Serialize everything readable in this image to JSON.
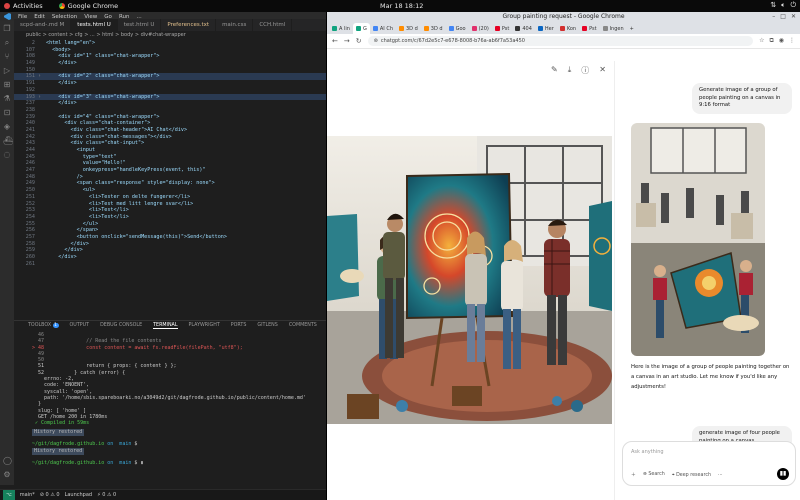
{
  "topbar": {
    "activities": "Activities",
    "app_name": "Google Chrome",
    "clock": "Mar 18  18:12",
    "tray_icons": [
      "network-icon",
      "volume-icon",
      "power-icon"
    ]
  },
  "vscode": {
    "menu": [
      "File",
      "Edit",
      "Selection",
      "View",
      "Go",
      "Run",
      "..."
    ],
    "tabs": [
      {
        "label": "scpd-and-.md M",
        "state": "normal"
      },
      {
        "label": "tests.html U",
        "state": "active"
      },
      {
        "label": "test.html U",
        "state": "normal"
      },
      {
        "label": "Preferences.txt",
        "state": "modified"
      },
      {
        "label": "main.css",
        "state": "normal"
      },
      {
        "label": "CCH.html",
        "state": "normal"
      }
    ],
    "breadcrumb": "public > content > cfg > ... > html > body > div#chat-wrapper",
    "code_lines": [
      {
        "n": "2",
        "text": "<html lang=\"en\">",
        "hl": false
      },
      {
        "n": "107",
        "text": "  <body>",
        "hl": false
      },
      {
        "n": "108",
        "text": "    <div id=\"1\" class=\"chat-wrapper\">",
        "hl": false
      },
      {
        "n": "149",
        "text": "    </div>",
        "hl": false
      },
      {
        "n": "150",
        "text": "",
        "hl": false
      },
      {
        "n": "151",
        "text": "    <div id=\"2\" class=\"chat-wrapper\">",
        "hl": true
      },
      {
        "n": "191",
        "text": "    </div>",
        "hl": false
      },
      {
        "n": "192",
        "text": "",
        "hl": false
      },
      {
        "n": "193",
        "text": "    <div id=\"3\" class=\"chat-wrapper\">",
        "hl": true
      },
      {
        "n": "237",
        "text": "    </div>",
        "hl": false
      },
      {
        "n": "238",
        "text": "",
        "hl": false
      },
      {
        "n": "239",
        "text": "    <div id=\"4\" class=\"chat-wrapper\">",
        "hl": false
      },
      {
        "n": "240",
        "text": "      <div class=\"chat-container\">",
        "hl": false
      },
      {
        "n": "241",
        "text": "        <div class=\"chat-header\">AI Chat</div>",
        "hl": false
      },
      {
        "n": "242",
        "text": "        <div class=\"chat-messages\"></div>",
        "hl": false
      },
      {
        "n": "243",
        "text": "        <div class=\"chat-input\">",
        "hl": false
      },
      {
        "n": "244",
        "text": "          <input",
        "hl": false
      },
      {
        "n": "245",
        "text": "            type=\"text\"",
        "hl": false
      },
      {
        "n": "246",
        "text": "            value=\"Hello!\"",
        "hl": false
      },
      {
        "n": "247",
        "text": "            onkeypress=\"handleKeyPress(event, this)\"",
        "hl": false
      },
      {
        "n": "248",
        "text": "          />",
        "hl": false
      },
      {
        "n": "249",
        "text": "          <span class=\"response\" style=\"display: none\">",
        "hl": false
      },
      {
        "n": "250",
        "text": "            <ul>",
        "hl": false
      },
      {
        "n": "251",
        "text": "              <li>Tester on delte fungerer</li>",
        "hl": false
      },
      {
        "n": "252",
        "text": "              <li>Test med litt lengre svar</li>",
        "hl": false
      },
      {
        "n": "253",
        "text": "              <li>Test</li>",
        "hl": false
      },
      {
        "n": "254",
        "text": "              <li>Test</li>",
        "hl": false
      },
      {
        "n": "255",
        "text": "            </ul>",
        "hl": false
      },
      {
        "n": "256",
        "text": "          </span>",
        "hl": false
      },
      {
        "n": "257",
        "text": "          <button onclick=\"sendMessage(this)\">Send</button>",
        "hl": false
      },
      {
        "n": "258",
        "text": "        </div>",
        "hl": false
      },
      {
        "n": "259",
        "text": "      </div>",
        "hl": false
      },
      {
        "n": "260",
        "text": "    </div>",
        "hl": false
      },
      {
        "n": "261",
        "text": "",
        "hl": false
      }
    ],
    "panel_tabs": [
      "TOOLBOX",
      "OUTPUT",
      "DEBUG CONSOLE",
      "TERMINAL",
      "PLAYWRIGHT",
      "PORTS",
      "GITLENS",
      "COMMENTS"
    ],
    "toolbox_badge": "1",
    "terminal_lines": [
      {
        "text": "  46",
        "cls": "gray"
      },
      {
        "text": "  47              // Read the file contents",
        "cls": "gray"
      },
      {
        "text": "> 48              const content = await fs.readFile(filePath, \"utf8\");",
        "cls": "red"
      },
      {
        "text": "  49",
        "cls": "gray"
      },
      {
        "text": "  50",
        "cls": "gray"
      },
      {
        "text": "  51              return { props: { content } };",
        "cls": ""
      },
      {
        "text": "  52          } catch (error) {",
        "cls": ""
      },
      {
        "text": "    errno: -2,",
        "cls": ""
      },
      {
        "text": "    code: 'ENOENT',",
        "cls": ""
      },
      {
        "text": "    syscall: 'open',",
        "cls": ""
      },
      {
        "text": "    path: '/home/sbis.spareboarki.no/a3049d2/git/dagfrode.github.io/public/content/home.md'",
        "cls": ""
      },
      {
        "text": "  }",
        "cls": ""
      },
      {
        "text": "  slug: [ 'home' ]",
        "cls": ""
      },
      {
        "text": "  GET /home 200 in 1780ms",
        "cls": ""
      },
      {
        "text": " ✓ Compiled in 59ms",
        "cls": "green"
      }
    ],
    "history_restored_1": "History restored",
    "history_restored_2": "History restored",
    "prompt_path": "~/git/dagfrode.github.io",
    "prompt_branch": "on  main",
    "status_items": [
      "main*",
      "⊘ 0 ⚠ 0",
      "Launchpad",
      "⚡ 0 ⚠ 0"
    ]
  },
  "chrome": {
    "window_title": "Group painting request - Google Chrome",
    "tabs": [
      {
        "label": "A lin",
        "color": "#10a37f"
      },
      {
        "label": "G",
        "color": "#10a37f",
        "active": true
      },
      {
        "label": "AI Ch",
        "color": "#4285f4"
      },
      {
        "label": "3D d",
        "color": "#ff8c00"
      },
      {
        "label": "3D d",
        "color": "#ff8c00"
      },
      {
        "label": "Goo",
        "color": "#4285f4"
      },
      {
        "label": "(20)",
        "color": "#e1306c"
      },
      {
        "label": "Pst",
        "color": "#e60023"
      },
      {
        "label": "404",
        "color": "#333333"
      },
      {
        "label": "Her",
        "color": "#0a66c2"
      },
      {
        "label": "Kon",
        "color": "#d32f2f"
      },
      {
        "label": "Pst",
        "color": "#e60023"
      },
      {
        "label": "Ingen",
        "color": "#888888"
      }
    ],
    "url": "chatgpt.com/c/67d2e5c7-e678-8008-b76a-ab6f7a53a450",
    "lightbox_tools": [
      "edit-icon",
      "download-icon",
      "info-icon",
      "close-icon"
    ],
    "chat": {
      "user_message_1": "Generate image of a group of people painting on a canvas in 9:16 format",
      "assistant_reply": "Here is the image of a group of people painting together on a canvas in an art studio. Let me know if you'd like any adjustments!",
      "user_message_2": "generate image of four people painting on a canvas",
      "composer_placeholder": "Ask anything",
      "tool_search": "Search",
      "tool_reason": "Deep research",
      "tool_more": "..."
    }
  }
}
